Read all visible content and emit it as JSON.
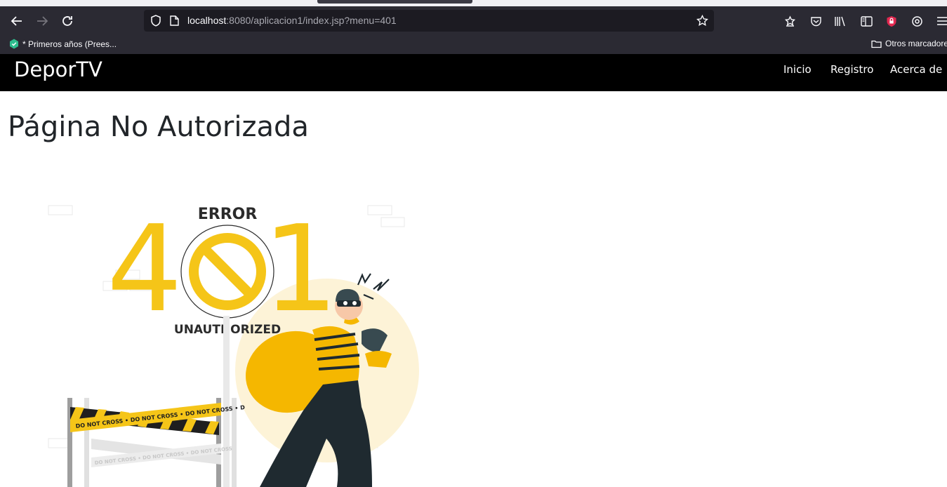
{
  "browser": {
    "url_host": "localhost",
    "url_rest": ":8080/aplicacion1/index.jsp?menu=401",
    "bookmarks": [
      {
        "label": "* Primeros años (Prees..."
      }
    ],
    "other_bookmarks_label": "Otros marcadore"
  },
  "navbar": {
    "brand": "DeporTV",
    "links": [
      {
        "label": "Inicio"
      },
      {
        "label": "Registro"
      },
      {
        "label": "Acerca de"
      }
    ]
  },
  "main": {
    "title": "Página No Autorizada",
    "illustration": {
      "error_label": "ERROR",
      "code_left": "4",
      "code_right": "1",
      "status_label": "UNAUTHORIZED",
      "tape_text": "DO NOT CROSS • DO NOT CROSS • DO NOT CROSS • D",
      "tape_text_faded": "DO NOT CROSS • DO NOT CROSS • DO NOT CROSS",
      "accent_color": "#f5c518"
    }
  }
}
